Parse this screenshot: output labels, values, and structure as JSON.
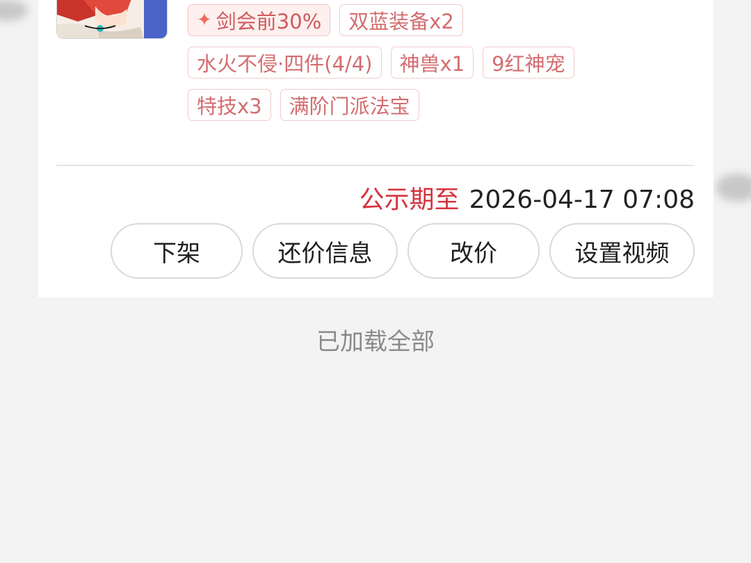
{
  "listing": {
    "tags": [
      [
        "剑会前30%",
        "双蓝装备x2"
      ],
      [
        "水火不侵·四件(4/4)",
        "神兽x1",
        "9红神宠"
      ],
      [
        "特技x3",
        "满阶门派法宝"
      ]
    ],
    "deadline_label": "公示期至",
    "deadline_value": "2026-04-17 07:08",
    "actions": [
      "下架",
      "还价信息",
      "改价",
      "设置视频"
    ]
  },
  "footer": {
    "loaded_text": "已加载全部"
  },
  "colors": {
    "accent_red": "#d4343d",
    "tag_text": "#d36d70",
    "tag_border": "#f2cbcb"
  },
  "icons": {
    "tag_star": "sparkle-icon"
  }
}
